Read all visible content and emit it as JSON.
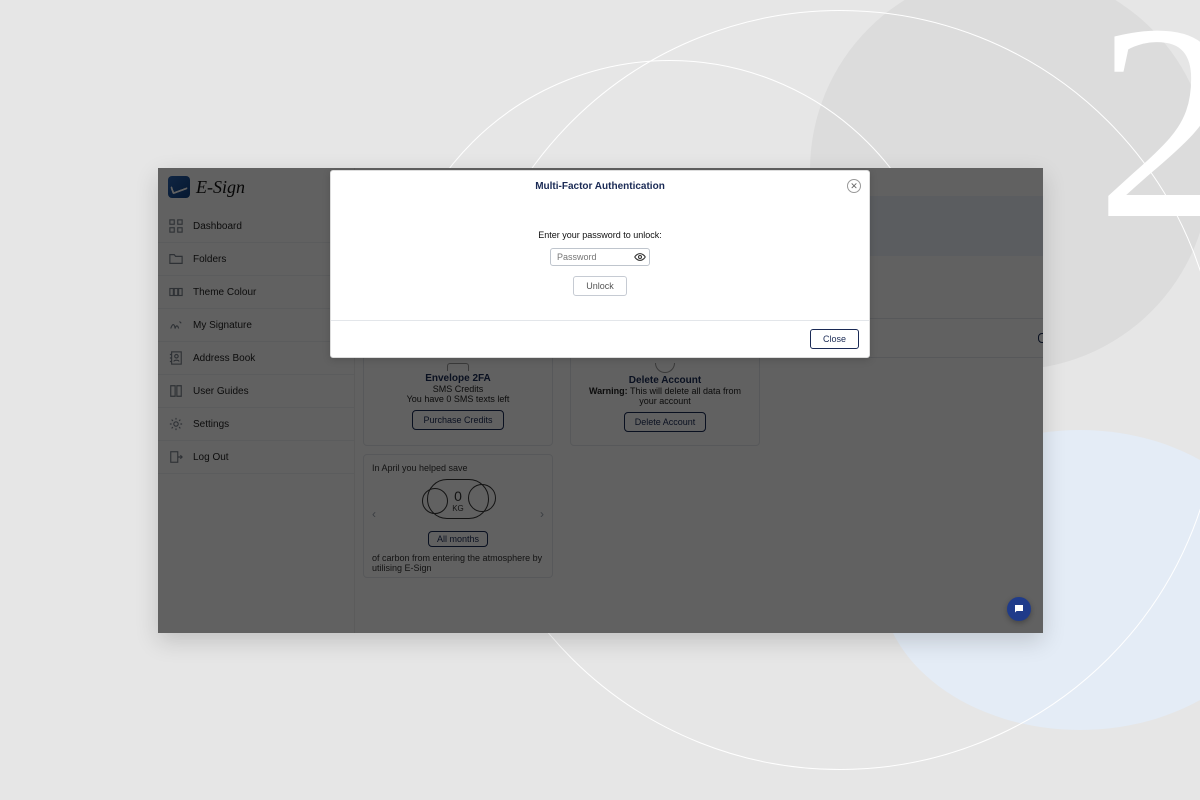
{
  "decor": {
    "big_number": "2"
  },
  "brand": {
    "name": "E-Sign"
  },
  "sidebar": {
    "items": [
      {
        "label": "Dashboard"
      },
      {
        "label": "Folders"
      },
      {
        "label": "Theme Colour"
      },
      {
        "label": "My Signature"
      },
      {
        "label": "Address Book"
      },
      {
        "label": "User Guides"
      },
      {
        "label": "Settings"
      },
      {
        "label": "Log Out"
      }
    ]
  },
  "cards": {
    "envelope2fa": {
      "title": "Envelope 2FA",
      "credits_label": "SMS Credits",
      "remaining_text": "You have 0 SMS texts left",
      "purchase_btn": "Purchase Credits"
    },
    "delete_account": {
      "title": "Delete Account",
      "warning_label": "Warning:",
      "warning_text": " This will delete all data from your account",
      "button": "Delete Account"
    },
    "carbon": {
      "headline_prefix": "In April you helped save",
      "value": "0",
      "unit": "KG",
      "all_months_btn": "All months",
      "footer_text": "of carbon from entering the atmosphere by utilising E-Sign"
    },
    "top_right_btn": ""
  },
  "modal": {
    "title": "Multi-Factor Authentication",
    "prompt": "Enter your password to unlock:",
    "placeholder": "Password",
    "unlock": "Unlock",
    "close": "Close"
  }
}
